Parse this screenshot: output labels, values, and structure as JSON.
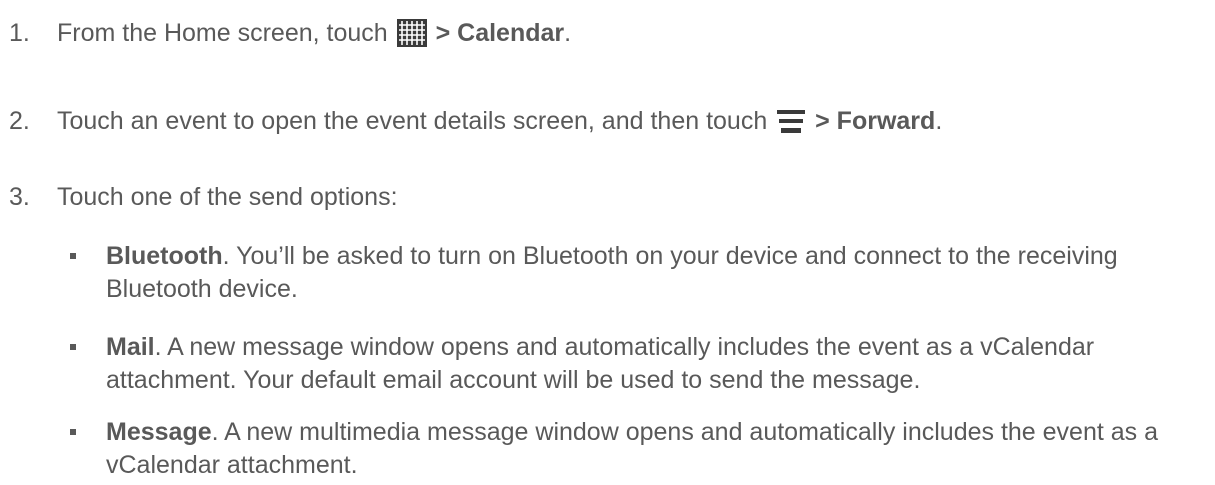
{
  "steps": [
    {
      "number": "1.",
      "prefix": "From the Home screen, touch ",
      "icon": "apps-grid-icon",
      "bold": "> Calendar",
      "suffix": "."
    },
    {
      "number": "2.",
      "prefix": "Touch an event to open the event details screen, and then touch ",
      "icon": "menu-icon",
      "bold": "> Forward",
      "suffix": "."
    },
    {
      "number": "3.",
      "text": "Touch one of the send options:"
    }
  ],
  "options": [
    {
      "title": "Bluetooth",
      "desc": ". You’ll be asked to turn on Bluetooth on your device and connect to the receiving Bluetooth device."
    },
    {
      "title": "Mail",
      "desc": ". A new message window opens and automatically includes the event as a vCalendar attachment. Your default email account will be used to send the message."
    },
    {
      "title": "Message",
      "desc": ". A new multimedia message window opens and automatically includes the event as a vCalendar attachment."
    }
  ],
  "colors": {
    "text": "#595959",
    "icon": "#3a3a3a",
    "background": "#ffffff"
  }
}
